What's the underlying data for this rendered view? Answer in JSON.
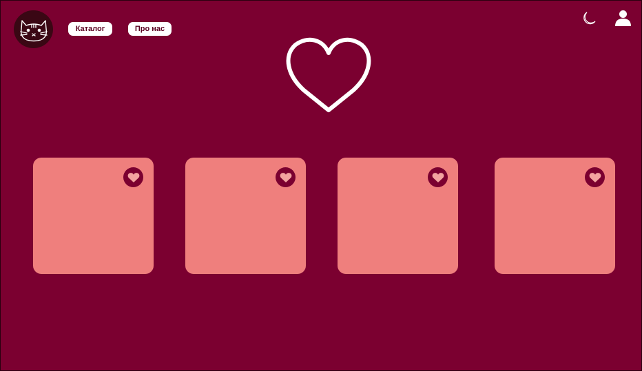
{
  "header": {
    "logo_icon": "cat-face-icon",
    "nav": [
      {
        "label": "Каталог"
      },
      {
        "label": "Про нас"
      }
    ],
    "theme_icon": "moon-icon",
    "profile_icon": "user-icon"
  },
  "hero": {
    "icon": "heart-outline-icon"
  },
  "cards": [
    {
      "favorite_icon": "heart-icon"
    },
    {
      "favorite_icon": "heart-icon"
    },
    {
      "favorite_icon": "heart-icon"
    },
    {
      "favorite_icon": "heart-icon"
    }
  ],
  "colors": {
    "background": "#7b0030",
    "card": "#ef7f7d",
    "logo_bg": "#3a0714",
    "heart_fill": "#f3a3a0",
    "button_bg": "#ffffff",
    "button_text": "#5a0020"
  }
}
